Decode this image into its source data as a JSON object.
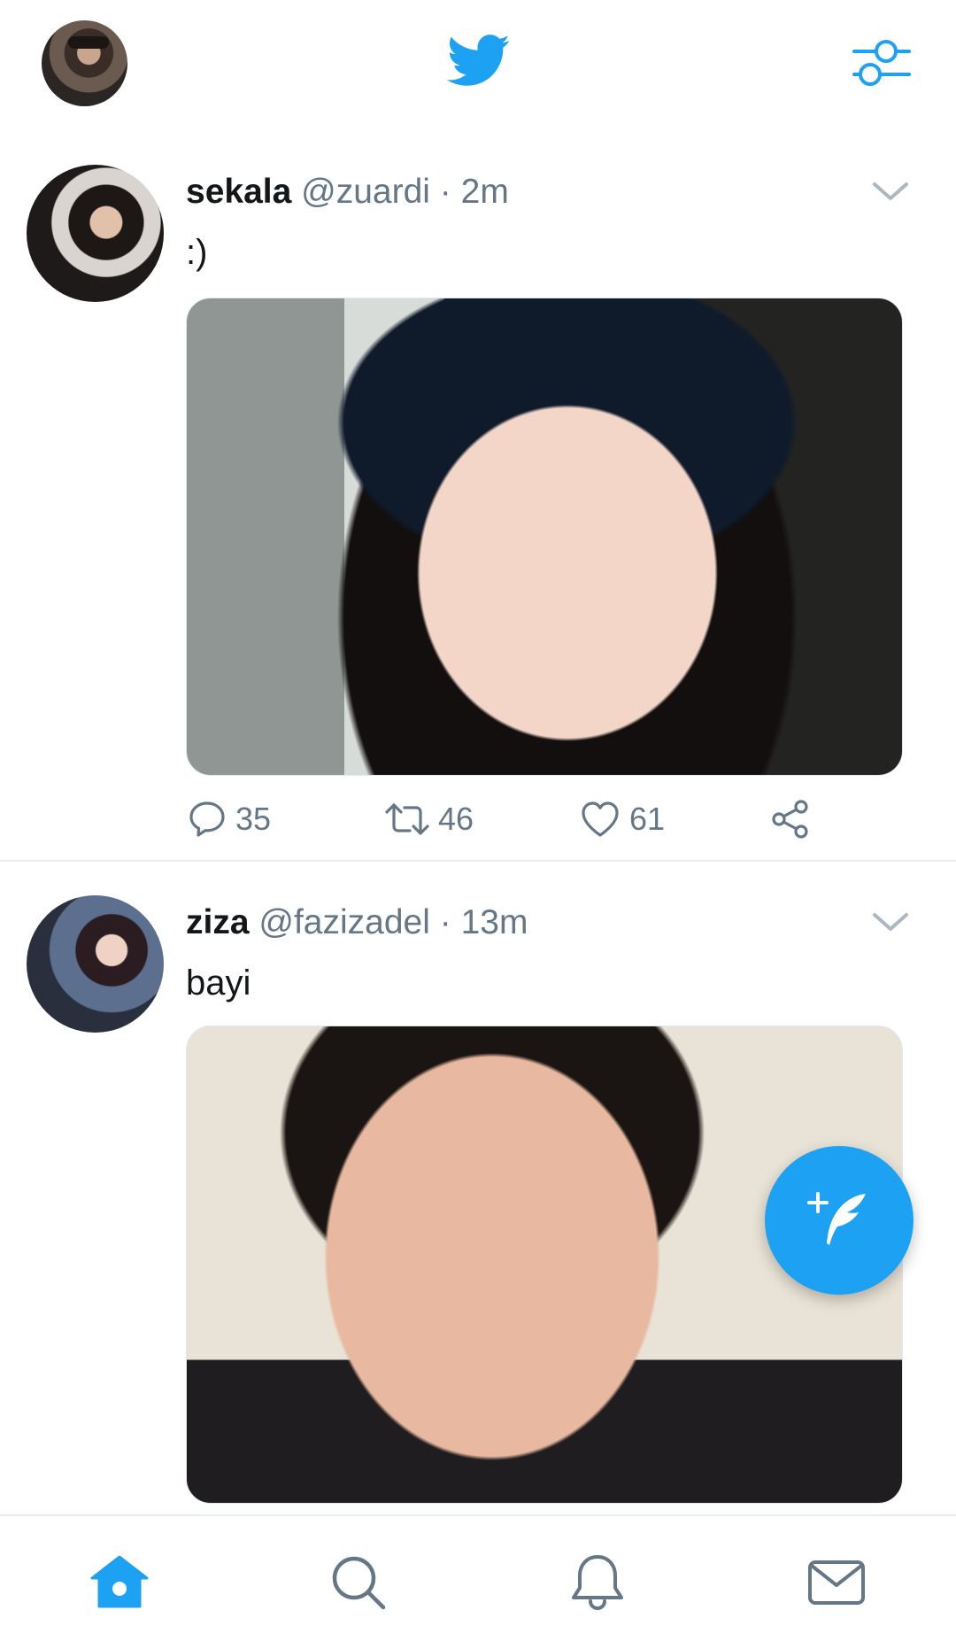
{
  "app": {
    "accent_color": "#1da1f2",
    "muted_color": "#657786"
  },
  "topbar": {
    "avatar_icon": "profile-avatar",
    "logo_icon": "twitter-bird-icon",
    "settings_icon": "filter-settings-icon"
  },
  "tweets": [
    {
      "name": "sekala",
      "handle": "@zuardi",
      "separator": "·",
      "time": "2m",
      "text": ":)",
      "replies": "35",
      "retweets": "46",
      "likes": "61"
    },
    {
      "name": "ziza",
      "handle": "@fazizadel",
      "separator": "·",
      "time": "13m",
      "text": "bayi"
    }
  ],
  "fab": {
    "icon": "compose-tweet-icon"
  },
  "bottom_nav": {
    "items": [
      {
        "icon": "home-icon",
        "active": true
      },
      {
        "icon": "search-icon",
        "active": false
      },
      {
        "icon": "notifications-icon",
        "active": false
      },
      {
        "icon": "messages-icon",
        "active": false
      }
    ]
  }
}
